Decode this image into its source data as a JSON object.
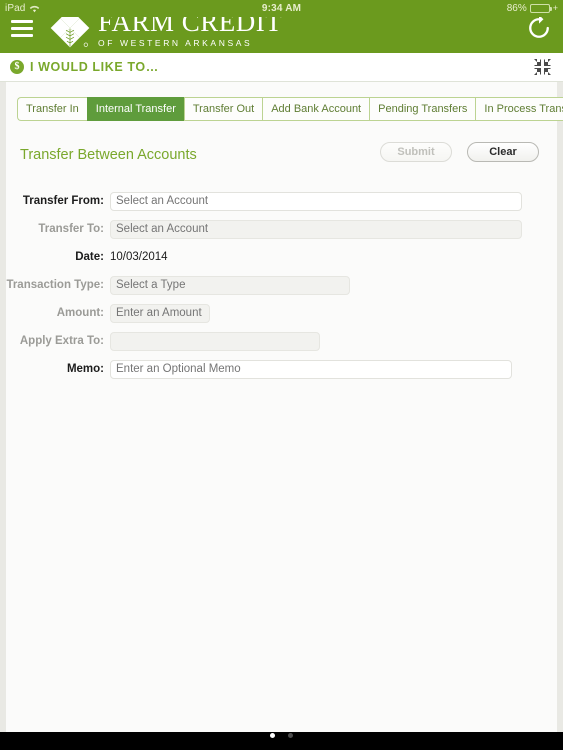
{
  "statusbar": {
    "device": "iPad",
    "wifi_icon": "wifi-icon",
    "time": "9:34 AM",
    "battery_percent": "86%",
    "battery_level": 86,
    "charging_glyph": "+"
  },
  "header": {
    "menu_icon": "hamburger-menu-icon",
    "logo_icon": "farm-credit-leaf-logo",
    "brand_title": "FARM CREDIT",
    "brand_subtitle": "OF WESTERN ARKANSAS",
    "refresh_icon": "refresh-icon",
    "background_color": "#6b9a1e"
  },
  "subheader": {
    "badge_icon": "dollar-sign-icon",
    "badge_glyph": "$",
    "title": "I WOULD LIKE TO…",
    "collapse_icon": "collapse-arrows-icon",
    "accent_color": "#7aa82c"
  },
  "tabs": [
    {
      "label": "Transfer In",
      "active": false
    },
    {
      "label": "Internal Transfer",
      "active": true
    },
    {
      "label": "Transfer Out",
      "active": false
    },
    {
      "label": "Add Bank Account",
      "active": false
    },
    {
      "label": "Pending Transfers",
      "active": false
    },
    {
      "label": "In Process Transfers",
      "active": false
    }
  ],
  "panel": {
    "title": "Transfer Between Accounts",
    "title_color": "#7aa82c",
    "submit_label": "Submit",
    "submit_disabled": true,
    "clear_label": "Clear",
    "clear_disabled": false
  },
  "form": {
    "fields": [
      {
        "label": "Transfer From:",
        "type": "select",
        "value": "",
        "placeholder": "Select an Account",
        "disabled": false
      },
      {
        "label": "Transfer To:",
        "type": "select",
        "value": "",
        "placeholder": "Select an Account",
        "disabled": true
      },
      {
        "label": "Date:",
        "type": "static",
        "value": "10/03/2014",
        "placeholder": "",
        "disabled": false
      },
      {
        "label": "Transaction Type:",
        "type": "select",
        "value": "",
        "placeholder": "Select a Type",
        "disabled": true
      },
      {
        "label": "Amount:",
        "type": "text",
        "value": "",
        "placeholder": "Enter an Amount",
        "disabled": true
      },
      {
        "label": "Apply Extra To:",
        "type": "text",
        "value": "",
        "placeholder": "",
        "disabled": true
      },
      {
        "label": "Memo:",
        "type": "text",
        "value": "",
        "placeholder": "Enter an Optional Memo",
        "disabled": false
      }
    ]
  },
  "pagination": {
    "dots": 2,
    "active_index": 0
  }
}
